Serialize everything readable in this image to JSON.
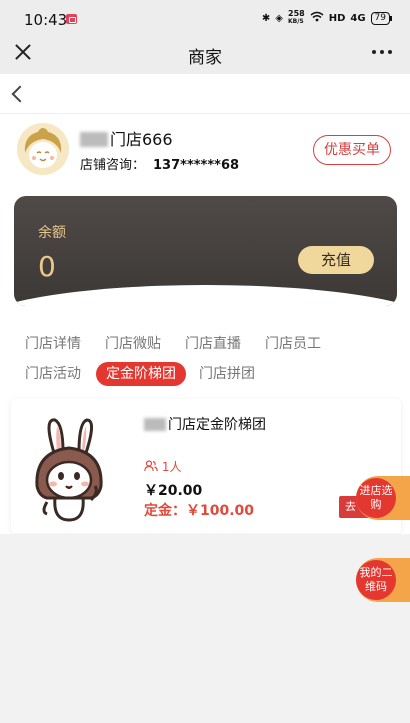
{
  "status_bar": {
    "time": "10:43",
    "speed_value": "258",
    "speed_unit": "KB/S",
    "network": "HD",
    "signal": "4G",
    "battery": "79"
  },
  "title_bar": {
    "title": "商家"
  },
  "store": {
    "name_suffix": "门店666",
    "phone_label": "店铺咨询：",
    "phone": "137******68",
    "discount_button": "优惠买单"
  },
  "balance": {
    "label": "余额",
    "value": "0",
    "recharge_button": "充值"
  },
  "tabs": [
    {
      "label": "门店详情"
    },
    {
      "label": "门店微贴"
    },
    {
      "label": "门店直播"
    },
    {
      "label": "门店员工"
    },
    {
      "label": "门店活动"
    },
    {
      "label": "定金阶梯团",
      "active": true
    },
    {
      "label": "门店拼团"
    }
  ],
  "product": {
    "title_suffix": "门店定金阶梯团",
    "people": "1人",
    "price": "￥20.00",
    "deposit": "定金：￥100.00",
    "go_button": "去"
  },
  "floating": {
    "enter_store": "进店选购",
    "my_qrcode": "我的二维码"
  },
  "colors": {
    "accent_red": "#e3372f",
    "gold": "#e9c88b",
    "card_dark": "#45403e",
    "float_orange": "#f4a54a"
  }
}
